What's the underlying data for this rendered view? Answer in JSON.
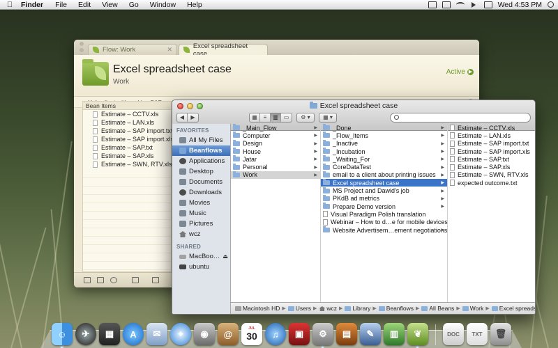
{
  "menubar": {
    "app": "Finder",
    "menus": [
      "File",
      "Edit",
      "View",
      "Go",
      "Window",
      "Help"
    ],
    "clock": "Wed 4:53 PM"
  },
  "flow": {
    "tabs": [
      {
        "label": "Flow: Work"
      },
      {
        "label": "Excel spreadsheet case"
      }
    ],
    "title": "Excel spreadsheet case",
    "subtitle": "Work",
    "status": "Active",
    "description": "Help client with making SAP and LAN estimates",
    "bean_header": "Bean Items",
    "beans": [
      "Estimate – CCTV.xls",
      "Estimate – LAN.xls",
      "Estimate – SAP import.txt",
      "Estimate – SAP import.xls",
      "Estimate – SAP.txt",
      "Estimate – SAP.xls",
      "Estimate – SWN, RTV.xls"
    ]
  },
  "finder": {
    "title": "Excel spreadsheet case",
    "search": {
      "placeholder": "",
      "value": ""
    },
    "sidebar": {
      "favorites_label": "FAVORITES",
      "favorites": [
        {
          "label": "All My Files",
          "icon": "all-files-icon"
        },
        {
          "label": "Beanflows",
          "icon": "folder-icon",
          "selected": true
        },
        {
          "label": "Applications",
          "icon": "applications-icon"
        },
        {
          "label": "Desktop",
          "icon": "desktop-icon"
        },
        {
          "label": "Documents",
          "icon": "documents-icon"
        },
        {
          "label": "Downloads",
          "icon": "downloads-icon"
        },
        {
          "label": "Movies",
          "icon": "movies-icon"
        },
        {
          "label": "Music",
          "icon": "music-icon"
        },
        {
          "label": "Pictures",
          "icon": "pictures-icon"
        },
        {
          "label": "wcz",
          "icon": "home-icon"
        }
      ],
      "shared_label": "SHARED",
      "shared": [
        {
          "label": "MacBoo…",
          "icon": "laptop-icon"
        },
        {
          "label": "ubuntu",
          "icon": "display-icon"
        }
      ]
    },
    "col1": [
      "_Main_Flow",
      "Computer",
      "Design",
      "House",
      "Jatar",
      "Personal",
      "Work"
    ],
    "col2": [
      {
        "label": "_Done",
        "type": "folder"
      },
      {
        "label": "_Flow_Items",
        "type": "folder"
      },
      {
        "label": "_Inactive",
        "type": "folder"
      },
      {
        "label": "_Incubation",
        "type": "folder"
      },
      {
        "label": "_Waiting_For",
        "type": "folder"
      },
      {
        "label": "CoreDataTest",
        "type": "folder"
      },
      {
        "label": "email to a client about printing issues",
        "type": "folder"
      },
      {
        "label": "Excel spreadsheet case",
        "type": "folder"
      },
      {
        "label": "MS Project and Dawid's job",
        "type": "folder"
      },
      {
        "label": "PKdB ad metrics",
        "type": "folder"
      },
      {
        "label": "Prepare Demo version",
        "type": "folder"
      },
      {
        "label": "Visual Paradigm Polish translation",
        "type": "doc"
      },
      {
        "label": "Webinar – How to d…e for mobile devices",
        "type": "doc"
      },
      {
        "label": "Website Advertisem…ement negotiations",
        "type": "folder"
      }
    ],
    "col3": [
      "Estimate – CCTV.xls",
      "Estimate – LAN.xls",
      "Estimate – SAP import.txt",
      "Estimate – SAP import.xls",
      "Estimate – SAP.txt",
      "Estimate – SAP.xls",
      "Estimate – SWN, RTV.xls",
      "expected outcome.txt"
    ],
    "path": [
      "Macintosh HD",
      "Users",
      "wcz",
      "Library",
      "Beanflows",
      "All Beans",
      "Work",
      "Excel spreadsheet case"
    ]
  },
  "dock": {
    "calendar_day": "30",
    "apps": [
      "finder-icon",
      "launchpad-icon",
      "mission-control-icon",
      "app-store-icon",
      "mail-icon",
      "safari-icon",
      "facetime-icon",
      "address-book-icon",
      "ical-icon",
      "itunes-icon",
      "photo-booth-icon",
      "system-preferences-icon",
      "keynote-icon",
      "preview-icon",
      "numbers-icon",
      "beanflows-icon"
    ],
    "stack": [
      "documents-stack-icon",
      "text-stack-icon",
      "trash-icon"
    ]
  }
}
